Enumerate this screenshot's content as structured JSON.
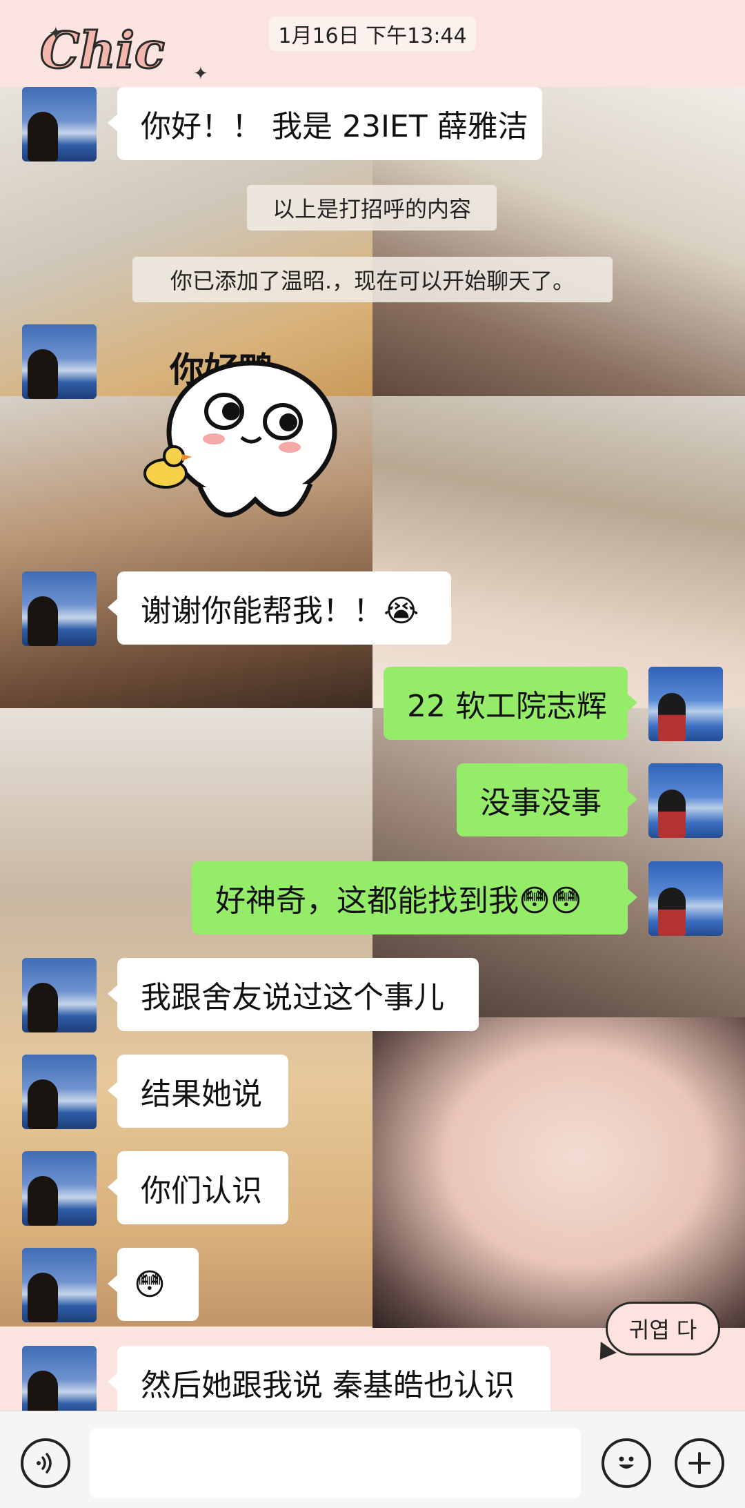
{
  "header": {
    "timestamp": "1月16日 下午13:44"
  },
  "decor": {
    "logo_text": "Chic",
    "corner_sticker_text": "귀엽 다"
  },
  "system_messages": [
    "以上是打招呼的内容",
    "你已添加了温昭.，现在可以开始聊天了。"
  ],
  "sticker": {
    "text": "你好鸭"
  },
  "messages": [
    {
      "side": "left",
      "text": "你好！！ 我是 23IET 薛雅洁"
    },
    {
      "side": "left",
      "text": "谢谢你能帮我！！😭"
    },
    {
      "side": "right",
      "text": "22 软工院志辉"
    },
    {
      "side": "right",
      "text": "没事没事"
    },
    {
      "side": "right",
      "text": "好神奇，这都能找到我😳😳"
    },
    {
      "side": "left",
      "text": "我跟舍友说过这个事儿"
    },
    {
      "side": "left",
      "text": "结果她说"
    },
    {
      "side": "left",
      "text": "你们认识"
    },
    {
      "side": "left",
      "text": "😳"
    },
    {
      "side": "left",
      "text": "然后她跟我说 秦基皓也认识"
    }
  ],
  "input_bar": {
    "voice_icon": "voice-icon",
    "emoji_icon": "emoji-icon",
    "plus_icon": "plus-icon",
    "input_value": ""
  },
  "colors": {
    "bubble_left": "#ffffff",
    "bubble_right": "#95ec69",
    "background": "#fbe3df"
  }
}
